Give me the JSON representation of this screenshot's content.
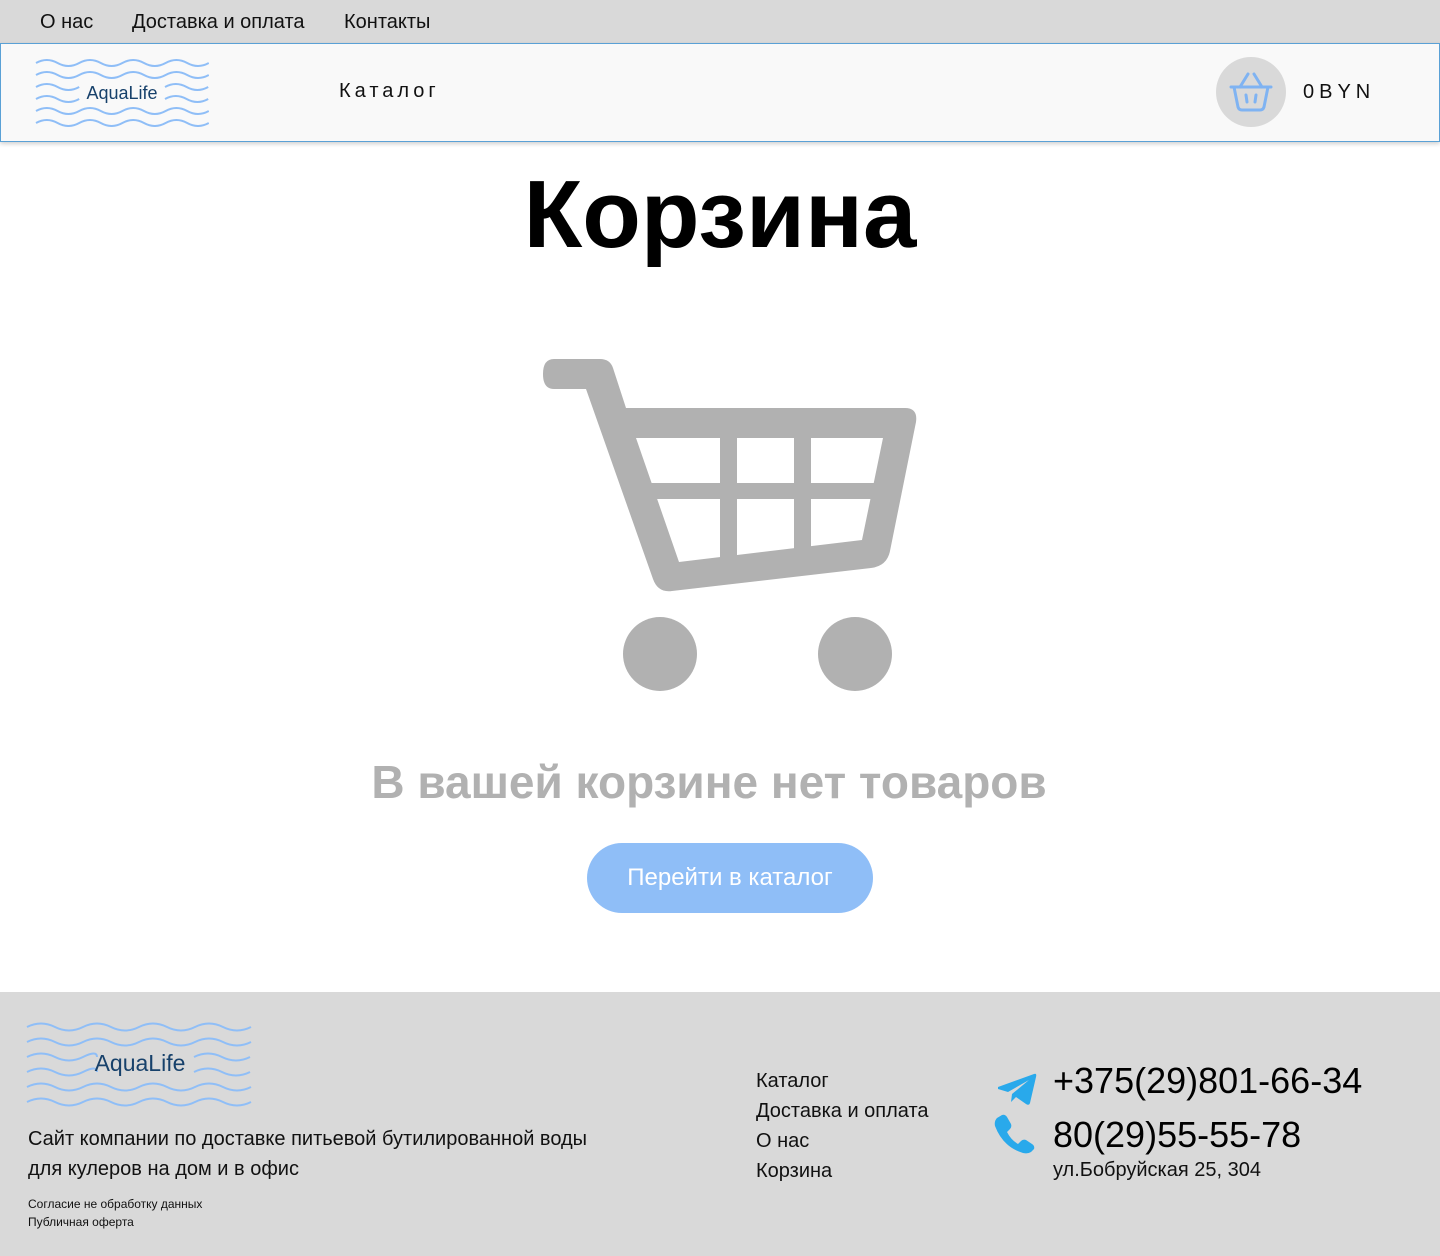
{
  "topnav": {
    "about": "О нас",
    "delivery": "Доставка и оплата",
    "contacts": "Контакты"
  },
  "header": {
    "logo_text": "AquaLife",
    "catalog": "Каталог",
    "cart_total": "0BYN"
  },
  "main": {
    "title": "Корзина",
    "empty_message": "В вашей корзине нет товаров",
    "go_catalog_button": "Перейти в каталог"
  },
  "footer": {
    "logo_text": "AquaLife",
    "description_line1": "Сайт компании по доставке питьевой бутилированной воды",
    "description_line2": "для кулеров на дом и в офис",
    "consent": "Согласие не обработку данных",
    "offer": "Публичная оферта",
    "links": [
      "Каталог",
      "Доставка и оплата",
      "О нас",
      "Корзина"
    ],
    "phone_telegram": "+375(29)801-66-34",
    "phone": "80(29)55-55-78",
    "address": "ул.Бобруйская 25, 304"
  },
  "colors": {
    "accent": "#8fbef7",
    "header_border": "#5aa1d6",
    "gray_bg": "#d9d9d9",
    "muted_text": "#b1b1b1",
    "icon_blue": "#29a9eb"
  }
}
